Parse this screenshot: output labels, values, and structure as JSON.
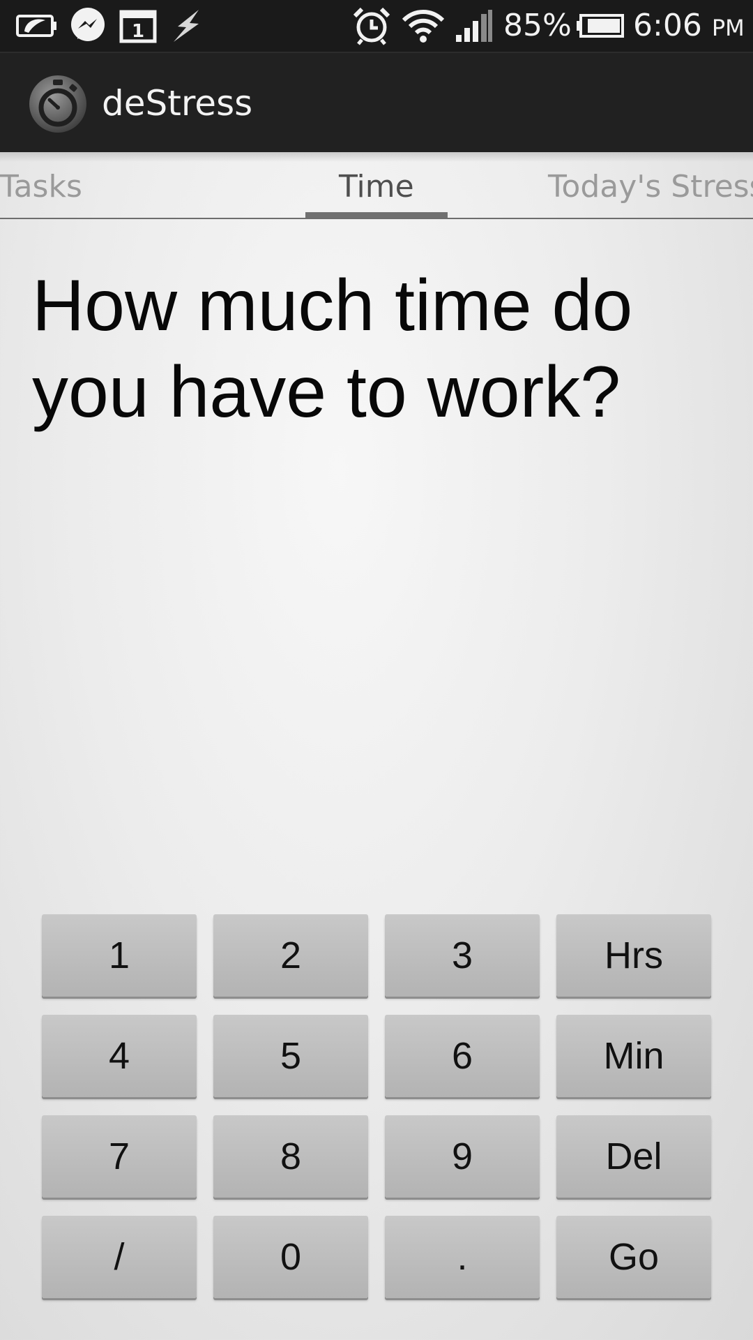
{
  "status_bar": {
    "battery_percent": "85%",
    "time": "6:06",
    "ampm": "PM",
    "icons_left": [
      "battery-saver-icon",
      "messenger-icon",
      "calendar-icon",
      "flash-icon"
    ],
    "icons_right": [
      "alarm-icon",
      "wifi-icon",
      "signal-icon",
      "battery-icon"
    ],
    "calendar_day": "1"
  },
  "action_bar": {
    "title": "deStress",
    "icon": "stopwatch-icon"
  },
  "tabs": [
    {
      "label": "Tasks",
      "active": false
    },
    {
      "label": "Time",
      "active": true
    },
    {
      "label": "Today's Stress",
      "active": false
    }
  ],
  "question": "How much time do you have to work?",
  "keypad": {
    "rows": [
      [
        "1",
        "2",
        "3",
        "Hrs"
      ],
      [
        "4",
        "5",
        "6",
        "Min"
      ],
      [
        "7",
        "8",
        "9",
        "Del"
      ],
      [
        "/",
        "0",
        ".",
        "Go"
      ]
    ]
  },
  "colors": {
    "status_bar_bg": "#1a1a1a",
    "action_bar_bg": "#212121",
    "key_bg": "#bdbdbd"
  }
}
